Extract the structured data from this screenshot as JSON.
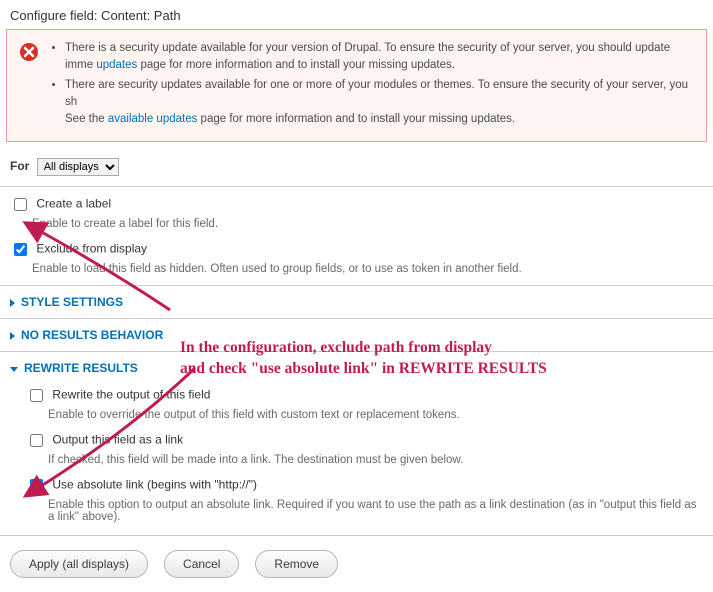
{
  "title": "Configure field: Content: Path",
  "alert": {
    "line1_pre": "There is a security update available for your version of Drupal. To ensure the security of your server, you should update imme",
    "link1": "updates",
    "line1_post": " page for more information and to install your missing updates.",
    "line2_pre": "There are security updates available for one or more of your modules or themes. To ensure the security of your server, you sh",
    "line2_mid": "See the ",
    "link2": "available updates",
    "line2_post": " page for more information and to install your missing updates."
  },
  "for": {
    "label": "For",
    "selected": "All displays"
  },
  "opts": {
    "create_label": {
      "label": "Create a label",
      "desc": "Enable to create a label for this field."
    },
    "exclude": {
      "label": "Exclude from display",
      "desc": "Enable to load this field as hidden. Often used to group fields, or to use as token in another field."
    }
  },
  "fieldsets": {
    "style": "STYLE SETTINGS",
    "noresults": "NO RESULTS BEHAVIOR",
    "rewrite": "REWRITE RESULTS"
  },
  "rewrite": {
    "rewrite_output": {
      "label": "Rewrite the output of this field",
      "desc": "Enable to override the output of this field with custom text or replacement tokens."
    },
    "as_link": {
      "label": "Output this field as a link",
      "desc": "If checked, this field will be made into a link. The destination must be given below."
    },
    "absolute": {
      "label": "Use absolute link (begins with \"http://\")",
      "desc": "Enable this option to output an absolute link. Required if you want to use the path as a link destination (as in \"output this field as a link\" above)."
    }
  },
  "buttons": {
    "apply": "Apply (all displays)",
    "cancel": "Cancel",
    "remove": "Remove"
  },
  "annotation": "In the configuration, exclude path from display\nand check \"use absolute link\" in REWRITE RESULTS"
}
